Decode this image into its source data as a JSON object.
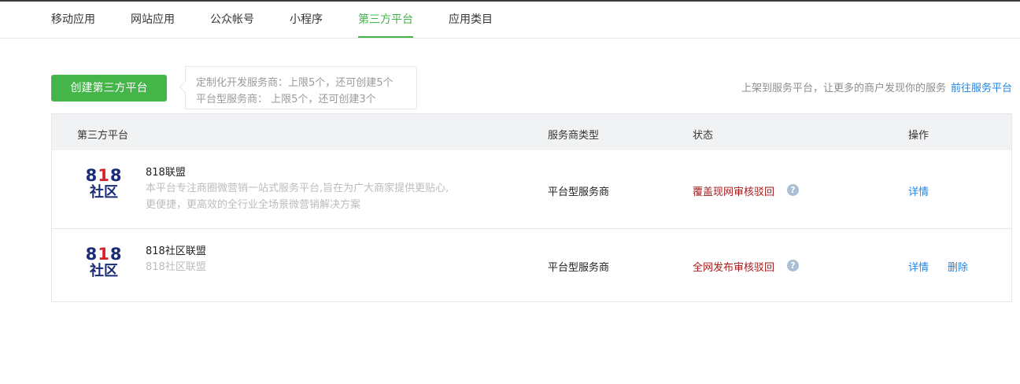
{
  "tabs": [
    {
      "label": "移动应用",
      "active": false
    },
    {
      "label": "网站应用",
      "active": false
    },
    {
      "label": "公众帐号",
      "active": false
    },
    {
      "label": "小程序",
      "active": false
    },
    {
      "label": "第三方平台",
      "active": true
    },
    {
      "label": "应用类目",
      "active": false
    }
  ],
  "toolbar": {
    "create_label": "创建第三方平台",
    "tip_line1": "定制化开发服务商：上限5个，还可创建5个",
    "tip_line2": "平台型服务商： 上限5个，还可创建3个",
    "right_text": "上架到服务平台，让更多的商户发现你的服务",
    "right_link": "前往服务平台"
  },
  "table": {
    "headers": [
      "第三方平台",
      "服务商类型",
      "状态",
      "操作"
    ],
    "rows": [
      {
        "logo_number": "818",
        "logo_text": "社区",
        "name": "818联盟",
        "desc_line1": "本平台专注商圈微营销一站式服务平台,旨在为广大商家提供更贴心,",
        "desc_line2": "更便捷，更高效的全行业全场景微营销解决方案",
        "type": "平台型服务商",
        "status": "覆盖现网审核驳回",
        "help_icon": "question-mark-icon",
        "actions": [
          "详情"
        ]
      },
      {
        "logo_number": "818",
        "logo_text": "社区",
        "name": "818社区联盟",
        "desc_line1": "818社区联盟",
        "type": "平台型服务商",
        "status": "全网发布审核驳回",
        "help_icon": "question-mark-icon",
        "actions": [
          "详情",
          "删除"
        ]
      }
    ]
  },
  "colors": {
    "accent_green": "#44b549",
    "link_blue": "#1e86e6",
    "status_red": "#a61a1a",
    "header_bg": "#f0f2f4"
  }
}
